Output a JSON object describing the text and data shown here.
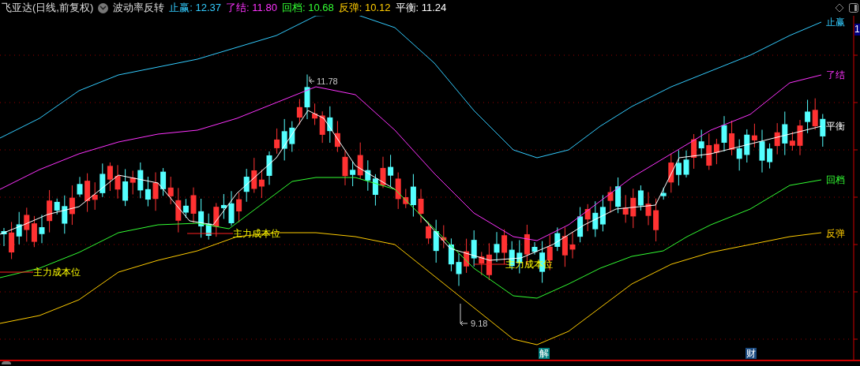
{
  "header": {
    "stock": "飞亚达(日线,前复权)",
    "indicator": "波动率反转",
    "readings": [
      {
        "label": "止赢:",
        "value": "12.37",
        "color": "#33ccff"
      },
      {
        "label": "了结:",
        "value": "11.80",
        "color": "#ff33ff"
      },
      {
        "label": "回档:",
        "value": "10.68",
        "color": "#33ff33"
      },
      {
        "label": "反弹:",
        "value": "10.12",
        "color": "#ffcc00"
      },
      {
        "label": "平衡:",
        "value": "11.24",
        "color": "#ffffff"
      }
    ]
  },
  "line_labels": [
    {
      "text": "止赢",
      "color": "#33ccff"
    },
    {
      "text": "了结",
      "color": "#ff33ff"
    },
    {
      "text": "平衡",
      "color": "#ffffff"
    },
    {
      "text": "回档",
      "color": "#33ff33"
    },
    {
      "text": "反弹",
      "color": "#ffcc00"
    }
  ],
  "annotations": [
    {
      "text": "11.78"
    },
    {
      "text": "9.18"
    }
  ],
  "cost_labels": [
    "主力成本位",
    "主力成本位",
    "主力成本位"
  ],
  "markers": [
    {
      "text": "解",
      "color": "#008080"
    },
    {
      "text": "财",
      "color": "#1a4a80"
    }
  ],
  "axis_label": "1"
}
